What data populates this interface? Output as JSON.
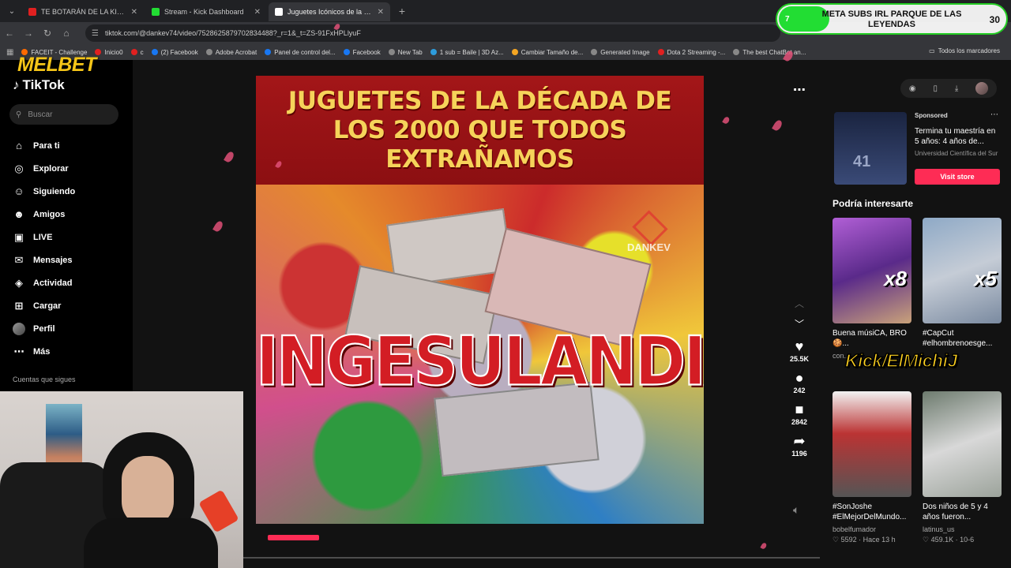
{
  "browser": {
    "tabs": [
      {
        "title": "TE BOTARÁN DE LA KING'S",
        "favicon_color": "#e02020",
        "active": false
      },
      {
        "title": "Stream - Kick Dashboard",
        "favicon_color": "#22dd33",
        "active": false
      },
      {
        "title": "Juguetes Icónicos de la Década",
        "favicon_color": "#ffffff",
        "active": true
      }
    ],
    "url": "tiktok.com/@dankev74/video/752862587970283448​8?_r=1&_t=ZS-91FxHPLlyuF",
    "bookmarks": [
      {
        "label": "FACEIT - Challenge",
        "color": "#ff6a00"
      },
      {
        "label": "Inicio0",
        "color": "#e02020"
      },
      {
        "label": "c",
        "color": "#e02020"
      },
      {
        "label": "(2) Facebook",
        "color": "#1877f2"
      },
      {
        "label": "Adobe Acrobat",
        "color": "#888888"
      },
      {
        "label": "Panel de control del...",
        "color": "#1877f2"
      },
      {
        "label": "Facebook",
        "color": "#1877f2"
      },
      {
        "label": "New Tab",
        "color": "#888888"
      },
      {
        "label": "1 sub = Baile | 3D Az...",
        "color": "#2d9cdb"
      },
      {
        "label": "Cambiar Tamaño de...",
        "color": "#f5a623"
      },
      {
        "label": "Generated Image",
        "color": "#888888"
      },
      {
        "label": "Dota 2 Streaming -...",
        "color": "#e02020"
      },
      {
        "label": "The best ChatBot an...",
        "color": "#888888"
      }
    ],
    "bookmarks_all": "Todos los marcadores"
  },
  "tiktok": {
    "logo": "TikTok",
    "search_placeholder": "Buscar",
    "nav": [
      {
        "label": "Para ti",
        "icon": "home-icon",
        "glyph": "⌂"
      },
      {
        "label": "Explorar",
        "icon": "compass-icon",
        "glyph": "◎"
      },
      {
        "label": "Siguiendo",
        "icon": "following-icon",
        "glyph": "☺"
      },
      {
        "label": "Amigos",
        "icon": "friends-icon",
        "glyph": "☻"
      },
      {
        "label": "LIVE",
        "icon": "live-icon",
        "glyph": "▣"
      },
      {
        "label": "Mensajes",
        "icon": "messages-icon",
        "glyph": "✉"
      },
      {
        "label": "Actividad",
        "icon": "activity-icon",
        "glyph": "◈"
      },
      {
        "label": "Cargar",
        "icon": "upload-icon",
        "glyph": "⊞"
      },
      {
        "label": "Perfil",
        "icon": "profile-avatar",
        "glyph": ""
      },
      {
        "label": "Más",
        "icon": "more-icon",
        "glyph": "⋯"
      }
    ],
    "following_title": "Cuentas que sigues",
    "video": {
      "title": "JUGUETES DE LA DÉCADA DE LOS 2000 QUE TODOS EXTRAÑAMOS",
      "overlay_text": "INGESULANDIA",
      "watermark": "DANKEV"
    },
    "actions": [
      {
        "name": "like",
        "icon": "heart-icon",
        "glyph": "♥",
        "value": "25.5K"
      },
      {
        "name": "comment",
        "icon": "comment-icon",
        "glyph": "●",
        "value": "242"
      },
      {
        "name": "save",
        "icon": "bookmark-icon",
        "glyph": "■",
        "value": "2842"
      },
      {
        "name": "share",
        "icon": "share-icon",
        "glyph": "➦",
        "value": "1196"
      }
    ],
    "ad": {
      "sponsored": "Sponsored",
      "title": "Termina tu maestría en 5 años: 4 años de...",
      "sub": "Universidad Científica del Sur",
      "button": "Visit store",
      "thumb_text": "41"
    },
    "recommend_heading": "Podría interesarte",
    "recommendations": [
      {
        "title": "Buena músiCA, BRO 🍪...",
        "author": "con...",
        "stats": "",
        "overlay": "x8",
        "bg": "linear-gradient(160deg,#b15fd6,#5a2a8a 50%,#c9a27a)"
      },
      {
        "title": "#CapCut #elhombrenoesge...",
        "author": "",
        "stats": "",
        "overlay": "x5",
        "bg": "linear-gradient(160deg,#8ea9c6,#c5ccd6 50%,#7a8aa0)"
      },
      {
        "title": "#SonJoshe #ElMejorDelMundo...",
        "author": "bobelfumador",
        "stats": "♡ 5592 · Hace 13 h",
        "overlay": "",
        "bg": "linear-gradient(180deg,#f2f2f2,#b33 40%,#555)"
      },
      {
        "title": "Dos niños de 5 y 4 años fueron...",
        "author": "latinus_us",
        "stats": "♡ 459.1K · 10-6",
        "overlay": "",
        "bg": "linear-gradient(160deg,#6d7b6e,#d8d8d8 50%,#9ca39b)"
      }
    ]
  },
  "stream_overlay": {
    "melbet": "MELBET",
    "goal_left": "7",
    "goal_text": "META SUBS IRL PARQUE DE LAS LEYENDAS",
    "goal_right": "30",
    "kick_handle": "Kick/ElMichiJ"
  }
}
